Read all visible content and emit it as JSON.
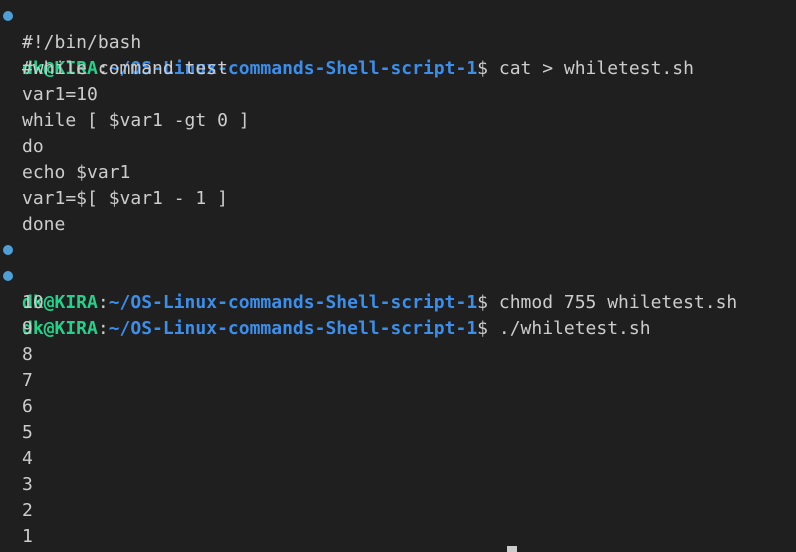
{
  "prompt": {
    "user_host": "dk@KIRA",
    "separator": ":",
    "path": "~/OS-Linux-commands-Shell-script-1",
    "symbol": "$"
  },
  "commands": [
    " cat > whiletest.sh",
    " chmod 755 whiletest.sh",
    " ./whiletest.sh"
  ],
  "script_lines": [
    "#!/bin/bash",
    "#while command test",
    "var1=10",
    "while [ $var1 -gt 0 ]",
    "do",
    "echo $var1",
    "var1=$[ $var1 - 1 ]",
    "done"
  ],
  "output_lines": [
    "10",
    "9",
    "8",
    "7",
    "6",
    "5",
    "4",
    "3",
    "2",
    "1"
  ],
  "colors": {
    "background": "#1f1f1f",
    "user_host": "#23d18b",
    "path": "#3b8eea",
    "text": "#cccccc",
    "decoration": "#4d9fd6"
  }
}
